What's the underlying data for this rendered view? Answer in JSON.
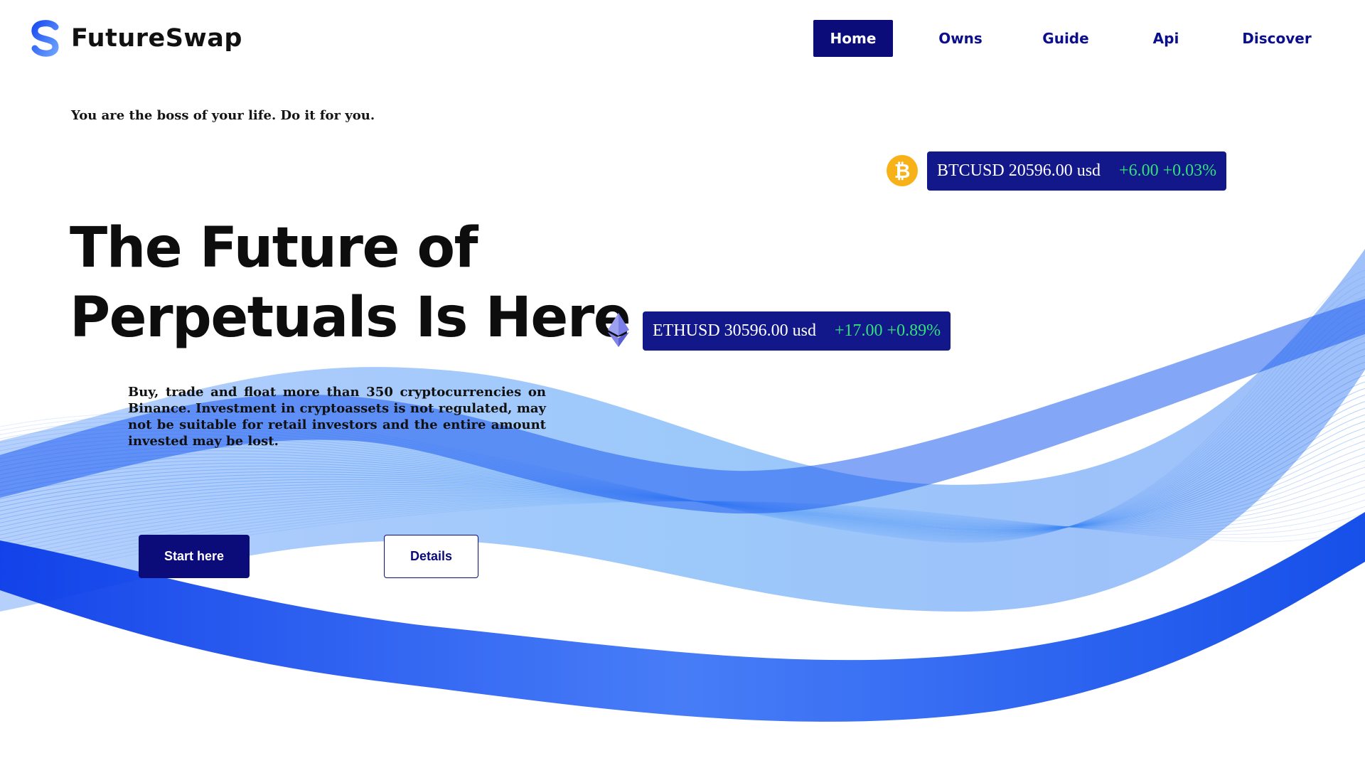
{
  "brand": {
    "name": "FutureSwap",
    "logo_icon": "s-logo-icon",
    "colors": {
      "primary": "#0b0c7a",
      "accent": "#1d4ff0",
      "positive": "#33e07a",
      "bitcoin": "#f7b21a"
    }
  },
  "nav": {
    "items": [
      {
        "label": "Home",
        "active": true
      },
      {
        "label": "Owns",
        "active": false
      },
      {
        "label": "Guide",
        "active": false
      },
      {
        "label": "Api",
        "active": false
      },
      {
        "label": "Discover",
        "active": false
      }
    ]
  },
  "hero": {
    "tagline": "You are the boss of your life. Do it for you.",
    "title_line1": "The Future of",
    "title_line2": "Perpetuals Is Here",
    "description": "Buy, trade and float more than 350 cryptocurrencies on Binance. Investment in cryptoassets is not regulated, may not be suitable for retail investors and the entire amount invested may be lost.",
    "start_label": "Start here",
    "details_label": "Details"
  },
  "tickers": {
    "btc": {
      "icon": "bitcoin-icon",
      "text": "BTCUSD 20596.00 usd",
      "change": "+6.00 +0.03%"
    },
    "eth": {
      "icon": "ethereum-icon",
      "text": "ETHUSD 30596.00 usd",
      "change": "+17.00 +0.89%"
    }
  }
}
